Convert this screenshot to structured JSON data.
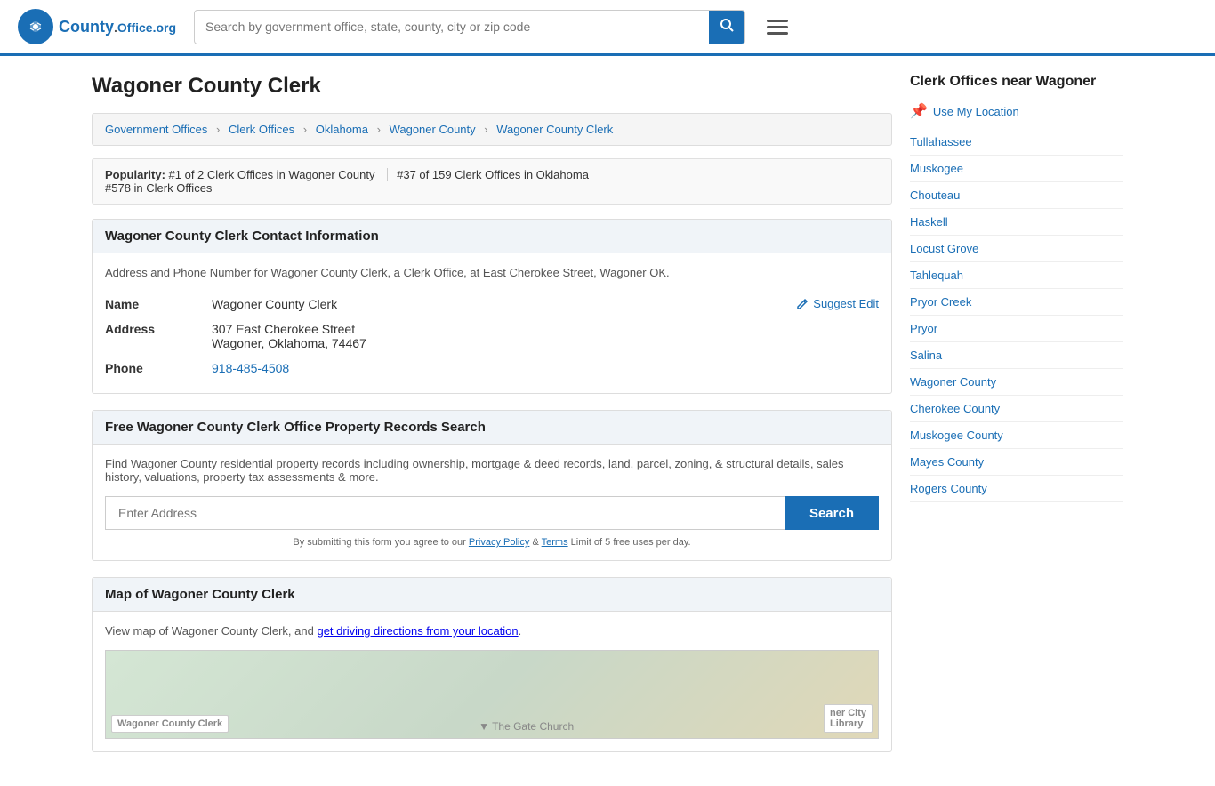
{
  "header": {
    "logo_text": "County",
    "logo_org": "Office.org",
    "search_placeholder": "Search by government office, state, county, city or zip code"
  },
  "breadcrumb": {
    "items": [
      {
        "label": "Government Offices",
        "href": "#"
      },
      {
        "label": "Clerk Offices",
        "href": "#"
      },
      {
        "label": "Oklahoma",
        "href": "#"
      },
      {
        "label": "Wagoner County",
        "href": "#"
      },
      {
        "label": "Wagoner County Clerk",
        "href": "#"
      }
    ]
  },
  "page_title": "Wagoner County Clerk",
  "popularity": {
    "prefix": "Popularity:",
    "rank1": "#1 of 2 Clerk Offices in Wagoner County",
    "rank2": "#37 of 159 Clerk Offices in Oklahoma",
    "rank3": "#578 in Clerk Offices"
  },
  "contact_section": {
    "title": "Wagoner County Clerk Contact Information",
    "description": "Address and Phone Number for Wagoner County Clerk, a Clerk Office, at East Cherokee Street, Wagoner OK.",
    "name_label": "Name",
    "name_value": "Wagoner County Clerk",
    "address_label": "Address",
    "address_line1": "307 East Cherokee Street",
    "address_line2": "Wagoner, Oklahoma, 74467",
    "phone_label": "Phone",
    "phone_value": "918-485-4508",
    "suggest_edit": "Suggest Edit"
  },
  "property_search": {
    "title": "Free Wagoner County Clerk Office Property Records Search",
    "description": "Find Wagoner County residential property records including ownership, mortgage & deed records, land, parcel, zoning, & structural details, sales history, valuations, property tax assessments & more.",
    "input_placeholder": "Enter Address",
    "search_button": "Search",
    "disclaimer": "By submitting this form you agree to our",
    "privacy_policy": "Privacy Policy",
    "and_text": "&",
    "terms": "Terms",
    "limit_text": "Limit of 5 free uses per day."
  },
  "map_section": {
    "title": "Map of Wagoner County Clerk",
    "description": "View map of Wagoner County Clerk, and",
    "directions_link": "get driving directions from your location",
    "map_label": "Wagoner County Clerk",
    "map_label2": "ner City\n Library",
    "map_label3": "The Gate Church"
  },
  "sidebar": {
    "title": "Clerk Offices near Wagoner",
    "use_location": "Use My Location",
    "links": [
      "Tullahassee",
      "Muskogee",
      "Chouteau",
      "Haskell",
      "Locust Grove",
      "Tahlequah",
      "Pryor Creek",
      "Pryor",
      "Salina",
      "Wagoner County",
      "Cherokee County",
      "Muskogee County",
      "Mayes County",
      "Rogers County"
    ]
  }
}
